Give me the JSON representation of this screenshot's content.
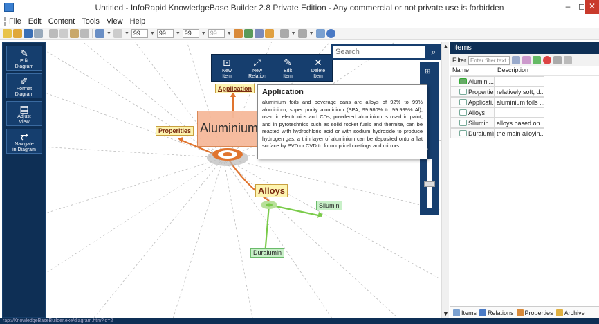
{
  "window": {
    "title": "Untitled - InfoRapid KnowledgeBase Builder 2.8 Private Edition - Any commercial or not private use is forbidden",
    "min": "–",
    "max": "◻",
    "close": "✕"
  },
  "menu": [
    "File",
    "Edit",
    "Content",
    "Tools",
    "View",
    "Help"
  ],
  "toolbar": {
    "fields": [
      "99",
      "99",
      "99",
      "99",
      "99"
    ]
  },
  "leftbar": {
    "buttons": [
      {
        "label": "Edit\nDiagram",
        "icon": "edit-icon"
      },
      {
        "label": "Format\nDiagram",
        "icon": "brush-icon"
      },
      {
        "label": "Adjust\nView",
        "icon": "screen-icon"
      },
      {
        "label": "Navigate\nin Diagram",
        "icon": "arrows-icon"
      }
    ]
  },
  "popup_toolbar": [
    {
      "label": "New\nItem",
      "icon": "new-item-icon",
      "glyph": "⊡"
    },
    {
      "label": "New\nRelation",
      "icon": "new-relation-icon",
      "glyph": "⤢"
    },
    {
      "label": "Edit\nItem",
      "icon": "edit-item-icon",
      "glyph": "✎"
    },
    {
      "label": "Delete\nItem",
      "icon": "delete-item-icon",
      "glyph": "✕"
    }
  ],
  "search": {
    "placeholder": "Search"
  },
  "diagram": {
    "main_node": "Aluminium",
    "nodes": [
      {
        "label": "Application"
      },
      {
        "label": "Properities"
      },
      {
        "label": "Alloys"
      },
      {
        "label": "Silumin"
      },
      {
        "label": "Duralumin"
      }
    ]
  },
  "tooltip": {
    "title": "Application",
    "body": "aluminium foils and beverage cans are alloys of 92% to 99% aluminium, super purity aluminium (SPA, 99.980% to 99.999% Al), used in electronics and CDs, powdered aluminium is used in paint, and in pyrotechnics such as solid rocket fuels and thermite, can be reacted with hydrochloric acid or with sodium hydroxide to produce hydrogen gas, a thin layer of aluminium can be deposited onto a flat surface by PVD or CVD to form optical coatings and mirrors"
  },
  "items_panel": {
    "header": "Items",
    "filter_label": "Filter",
    "filter_placeholder": "Enter filter text he",
    "columns": [
      "Name",
      "Description"
    ],
    "rows": [
      {
        "name": "Alumini...",
        "desc": "",
        "main": true
      },
      {
        "name": "Properties",
        "desc": "relatively soft, d..."
      },
      {
        "name": "Applicati...",
        "desc": "aluminium foils ..."
      },
      {
        "name": "Alloys",
        "desc": ""
      },
      {
        "name": "Silumin",
        "desc": "alloys based on ..."
      },
      {
        "name": "Duralumin",
        "desc": "the main alloyin..."
      }
    ],
    "tabs": [
      "Items",
      "Relations",
      "Properties",
      "Archive"
    ]
  },
  "status": "rap://KnowledgeBaseBuilder.exe/diagram.htm?id=2"
}
